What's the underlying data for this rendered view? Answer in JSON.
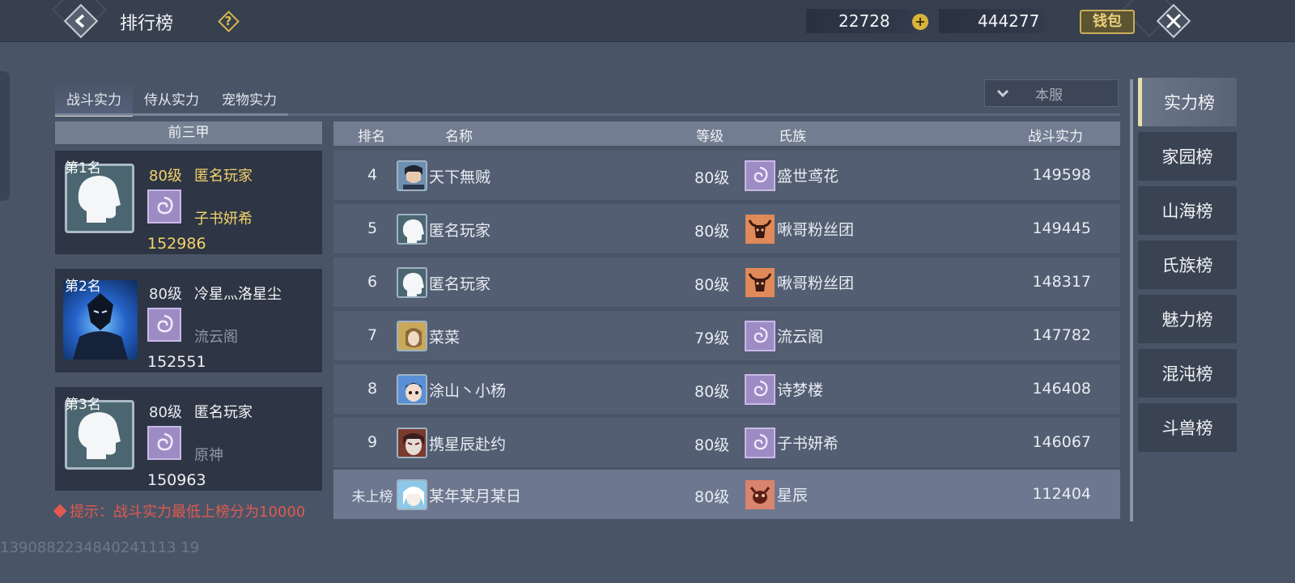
{
  "header": {
    "title": "排行榜",
    "help_icon": "?",
    "jade_amount": "22728",
    "gold_amount": "444277",
    "plus": "+",
    "wallet_label": "钱包"
  },
  "tabs": [
    {
      "label": "战斗实力",
      "active": true
    },
    {
      "label": "侍从实力",
      "active": false
    },
    {
      "label": "宠物实力",
      "active": false
    }
  ],
  "server_filter": {
    "label": "本服"
  },
  "top3": {
    "header": "前三甲",
    "entries": [
      {
        "rank": "第1名",
        "level": "80级",
        "name": "匿名玩家",
        "clan": "子书妍希",
        "power": "152986"
      },
      {
        "rank": "第2名",
        "level": "80级",
        "name": "冷星灬洛星尘",
        "clan": "流云阁",
        "power": "152551"
      },
      {
        "rank": "第3名",
        "level": "80级",
        "name": "匿名玩家",
        "clan": "原神",
        "power": "150963"
      }
    ]
  },
  "hint": "提示：战斗实力最低上榜分为10000",
  "uid": "1390882234840241113 19",
  "table": {
    "headers": {
      "rank": "排名",
      "name": "名称",
      "level": "等级",
      "clan": "氏族",
      "power": "战斗实力"
    },
    "rows": [
      {
        "rank": "4",
        "name": "天下無贼",
        "level": "80级",
        "clan": "盛世鸢花",
        "power": "149598",
        "avatar": "male-warrior-avatar",
        "clan_icon": "spiral-clan-icon"
      },
      {
        "rank": "5",
        "name": "匿名玩家",
        "level": "80级",
        "clan": "啾哥粉丝团",
        "power": "149445",
        "avatar": "anonymous-avatar",
        "clan_icon": "bull-clan-icon"
      },
      {
        "rank": "6",
        "name": "匿名玩家",
        "level": "80级",
        "clan": "啾哥粉丝团",
        "power": "148317",
        "avatar": "anonymous-avatar",
        "clan_icon": "bull-clan-icon"
      },
      {
        "rank": "7",
        "name": "菜菜",
        "level": "79级",
        "clan": "流云阁",
        "power": "147782",
        "avatar": "female-avatar",
        "clan_icon": "spiral-clan-icon"
      },
      {
        "rank": "8",
        "name": "涂山丶小杨",
        "level": "80级",
        "clan": "诗梦楼",
        "power": "146408",
        "avatar": "child-avatar",
        "clan_icon": "spiral-clan-icon"
      },
      {
        "rank": "9",
        "name": "携星辰赴约",
        "level": "80级",
        "clan": "子书妍希",
        "power": "146067",
        "avatar": "masked-avatar",
        "clan_icon": "spiral-clan-icon"
      }
    ],
    "mine": {
      "rank": "未上榜",
      "name": "某年某月某日",
      "level": "80级",
      "clan": "星辰",
      "power": "112404",
      "avatar": "white-hair-avatar",
      "clan_icon": "demon-clan-icon"
    }
  },
  "boards": [
    "实力榜",
    "家园榜",
    "山海榜",
    "氏族榜",
    "魅力榜",
    "混沌榜",
    "斗兽榜"
  ],
  "colors": {
    "background": "#495467",
    "topbar": "#37404f",
    "gold_text": "#f3d26b",
    "hint_red": "#e05a4f"
  }
}
